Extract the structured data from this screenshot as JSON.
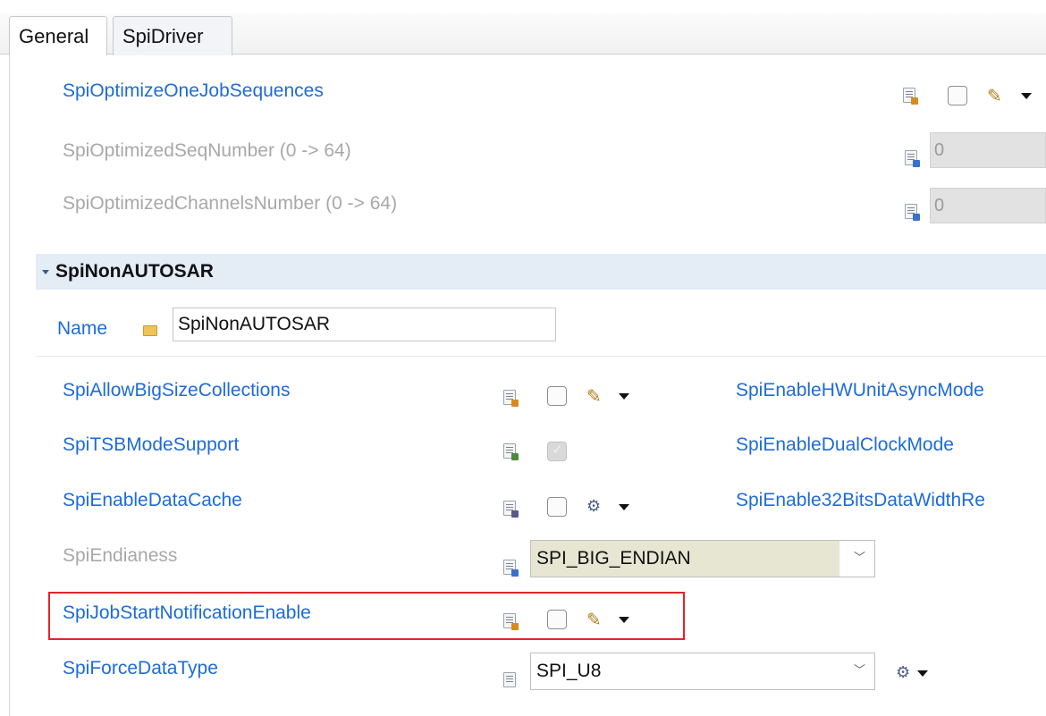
{
  "tabs": [
    {
      "label": "General"
    },
    {
      "label": "SpiDriver"
    }
  ],
  "top_rows": [
    {
      "label": "SpiOptimizeOneJobSequences",
      "enabled": true,
      "checked": false
    },
    {
      "label": "SpiOptimizedSeqNumber (0 -> 64)",
      "enabled": false,
      "value": "0"
    },
    {
      "label": "SpiOptimizedChannelsNumber (0 -> 64)",
      "enabled": false,
      "value": "0"
    }
  ],
  "section": {
    "title": "SpiNonAUTOSAR",
    "name_label": "Name",
    "name_value": "SpiNonAUTOSAR"
  },
  "params_left": [
    {
      "label": "SpiAllowBigSizeCollections",
      "enabled": true,
      "checked": false
    },
    {
      "label": "SpiTSBModeSupport",
      "enabled": true,
      "checked": true,
      "locked": true
    },
    {
      "label": "SpiEnableDataCache",
      "enabled": true,
      "checked": false
    },
    {
      "label": "SpiEndianess",
      "enabled": false,
      "value": "SPI_BIG_ENDIAN"
    },
    {
      "label": "SpiJobStartNotificationEnable",
      "enabled": true,
      "checked": false,
      "highlighted": true
    },
    {
      "label": "SpiForceDataType",
      "enabled": true,
      "value": "SPI_U8"
    }
  ],
  "params_right": [
    {
      "label": "SpiEnableHWUnitAsyncMode"
    },
    {
      "label": "SpiEnableDualClockMode"
    },
    {
      "label": "SpiEnable32BitsDataWidthRe"
    }
  ],
  "icons": {
    "param": "param-doc-icon",
    "edit": "pencil-icon",
    "calc": "calculator-icon",
    "menu": "dropdown-caret-icon",
    "folder": "folder-icon"
  },
  "colors": {
    "label_link": "#1e6bd8",
    "label_disabled": "#a8a8a8",
    "section_bg": "#e4ecf6",
    "endian_bg": "#e6e6d2",
    "highlight": "#e0252b"
  }
}
